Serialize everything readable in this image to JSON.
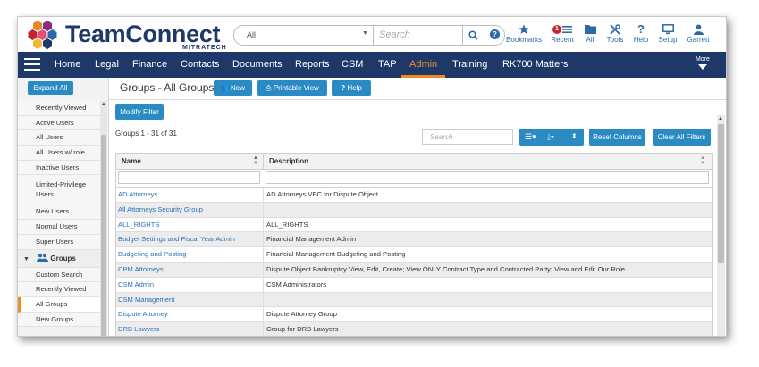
{
  "brand": {
    "name": "TeamConnect",
    "sub": "MITRATECH"
  },
  "search": {
    "scope": "All",
    "placeholder": "Search"
  },
  "toolbar": [
    {
      "label": "Bookmarks",
      "icon": "star-icon"
    },
    {
      "label": "Recent",
      "icon": "list-icon",
      "badge": "1"
    },
    {
      "label": "All",
      "icon": "folder-icon"
    },
    {
      "label": "Tools",
      "icon": "tools-icon"
    },
    {
      "label": "Help",
      "icon": "question-icon"
    },
    {
      "label": "Setup",
      "icon": "monitor-icon"
    },
    {
      "label": "Garrett",
      "icon": "user-icon"
    }
  ],
  "nav": {
    "items": [
      "Home",
      "Legal",
      "Finance",
      "Contacts",
      "Documents",
      "Reports",
      "CSM",
      "TAP",
      "Admin",
      "Training",
      "RK700 Matters"
    ],
    "active": "Admin",
    "more": "More"
  },
  "sidebar": {
    "expand_label": "Expand All",
    "users_items": [
      "Recently Viewed",
      "Active Users",
      "All Users",
      "All Users w/ role",
      "Inactive Users",
      "Limited-Privilege Users",
      "New Users",
      "Normal Users",
      "Super Users"
    ],
    "groups_title": "Groups",
    "groups_items": [
      "Custom Search",
      "Recently Viewed",
      "All Groups",
      "New Groups"
    ],
    "active": "All Groups"
  },
  "main": {
    "title": "Groups - All Groups",
    "buttons": {
      "new": "New",
      "printable": "Printable View",
      "help": "Help"
    },
    "modify_filter": "Modify Filter",
    "count": "Groups 1 - 31 of 31",
    "table_search_placeholder": "Search",
    "reset_columns": "Reset Columns",
    "clear_filters": "Clear All Filters",
    "columns": [
      "Name",
      "Description"
    ],
    "rows": [
      {
        "name": "AD Attorneys",
        "desc": "AD Attorneys VEC for Dispute Object"
      },
      {
        "name": "All Attorneys Security Group",
        "desc": ""
      },
      {
        "name": "ALL_RIGHTS",
        "desc": "ALL_RIGHTS"
      },
      {
        "name": "Budget Settings and Fiscal Year Admin",
        "desc": "Financial Management Admin"
      },
      {
        "name": "Budgeting and Posting",
        "desc": "Financial Management Budgeting and Posting"
      },
      {
        "name": "CPM Attorneys",
        "desc": "Dispute Object Bankruptcy View, Edit, Create; View ONLY Contract Type and Contracted Party; View and Edit Our Role"
      },
      {
        "name": "CSM Admin",
        "desc": "CSM Administrators"
      },
      {
        "name": "CSM Management",
        "desc": ""
      },
      {
        "name": "Dispute Attorney",
        "desc": "Dispute Attorney Group"
      },
      {
        "name": "DRB Lawyers",
        "desc": "Group for DRB Lawyers"
      }
    ]
  }
}
